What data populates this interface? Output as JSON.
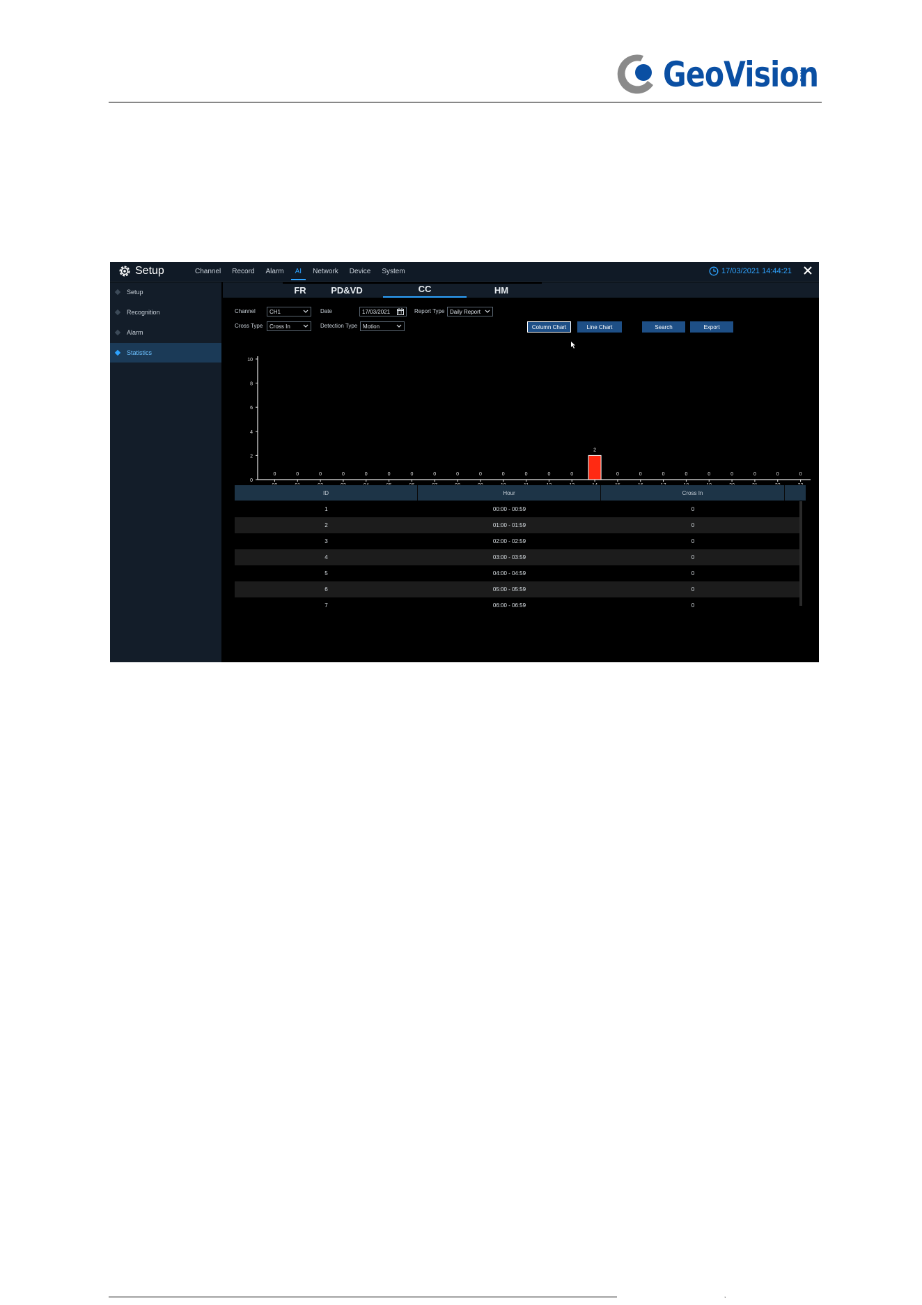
{
  "brand": {
    "name": "GeoVision",
    "suffix": "inc"
  },
  "app": {
    "title": "Setup",
    "menu": [
      "Channel",
      "Record",
      "Alarm",
      "AI",
      "Network",
      "Device",
      "System"
    ],
    "active_menu": "AI",
    "datetime": "17/03/2021 14:44:21"
  },
  "sidebar": {
    "items": [
      {
        "label": "Setup",
        "active": false
      },
      {
        "label": "Recognition",
        "active": false
      },
      {
        "label": "Alarm",
        "active": false
      },
      {
        "label": "Statistics",
        "active": true
      }
    ]
  },
  "tabs": {
    "items": [
      "FR",
      "PD&VD",
      "CC",
      "HM"
    ],
    "active": "CC"
  },
  "filters": {
    "channel_label": "Channel",
    "channel_value": "CH1",
    "date_label": "Date",
    "date_value": "17/03/2021",
    "report_type_label": "Report Type",
    "report_type_value": "Daily Report",
    "cross_type_label": "Cross Type",
    "cross_type_value": "Cross In",
    "detection_type_label": "Detection Type",
    "detection_type_value": "Motion"
  },
  "buttons": {
    "column_chart": "Column Chart",
    "line_chart": "Line Chart",
    "search": "Search",
    "export": "Export"
  },
  "chart_data": {
    "type": "bar",
    "categories": [
      "00",
      "01",
      "02",
      "03",
      "04",
      "05",
      "06",
      "07",
      "08",
      "09",
      "10",
      "11",
      "12",
      "13",
      "14",
      "15",
      "16",
      "17",
      "18",
      "19",
      "20",
      "21",
      "22",
      "23"
    ],
    "values": [
      0,
      0,
      0,
      0,
      0,
      0,
      0,
      0,
      0,
      0,
      0,
      0,
      0,
      0,
      2,
      0,
      0,
      0,
      0,
      0,
      0,
      0,
      0,
      0
    ],
    "yticks": [
      0,
      2,
      4,
      6,
      8,
      10
    ],
    "ylim": [
      0,
      10
    ],
    "bar_color": "#ff2a12",
    "grid": false
  },
  "table": {
    "columns": [
      "ID",
      "Hour",
      "Cross In"
    ],
    "rows": [
      [
        "1",
        "00:00 - 00:59",
        "0"
      ],
      [
        "2",
        "01:00 - 01:59",
        "0"
      ],
      [
        "3",
        "02:00 - 02:59",
        "0"
      ],
      [
        "4",
        "03:00 - 03:59",
        "0"
      ],
      [
        "5",
        "04:00 - 04:59",
        "0"
      ],
      [
        "6",
        "05:00 - 05:59",
        "0"
      ],
      [
        "7",
        "06:00 - 06:59",
        "0"
      ]
    ]
  },
  "colors": {
    "accent": "#2ea3ff",
    "brand": "#0a4fa3",
    "button": "#1e4f86"
  }
}
